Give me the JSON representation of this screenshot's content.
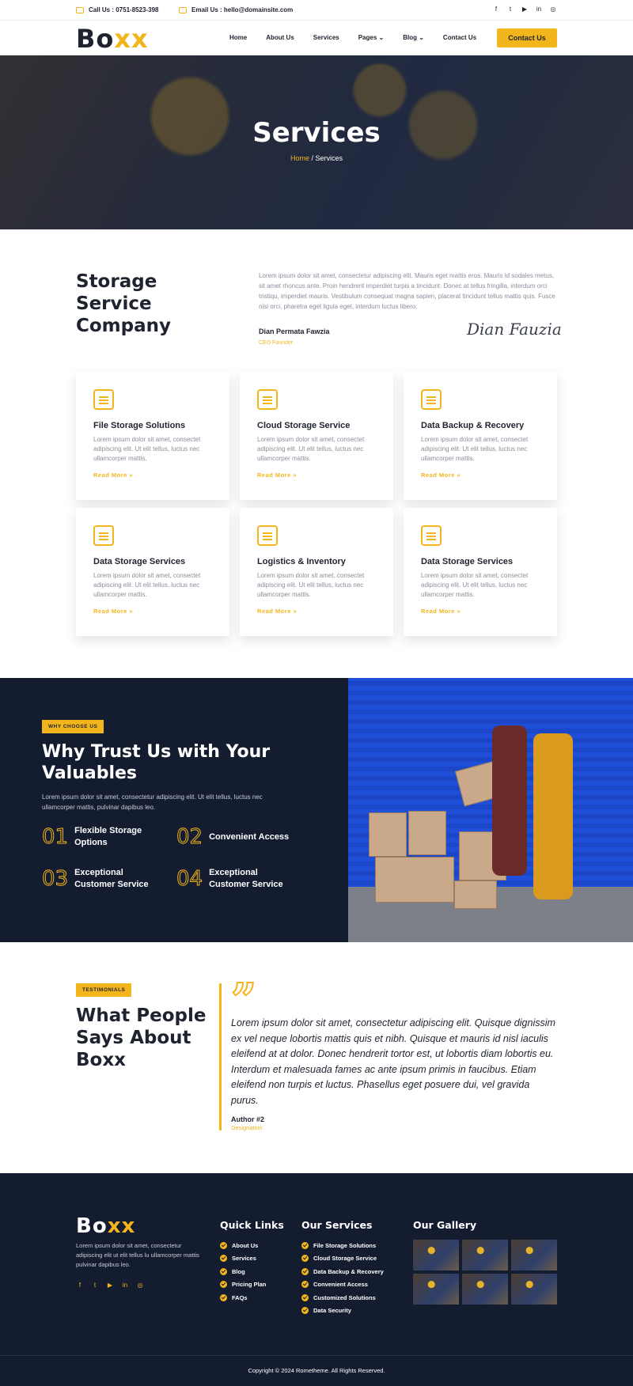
{
  "topbar": {
    "call": "Call Us : 0751-8523-398",
    "email": "Email Us : hello@domainsite.com",
    "socials": [
      "facebook-icon",
      "twitter-icon",
      "youtube-icon",
      "linkedin-icon",
      "instagram-icon"
    ]
  },
  "nav": {
    "logo_main": "Bo",
    "logo_accent": "xx",
    "items": [
      {
        "label": "Home"
      },
      {
        "label": "About Us"
      },
      {
        "label": "Services"
      },
      {
        "label": "Pages ⌄"
      },
      {
        "label": "Blog ⌄"
      },
      {
        "label": "Contact Us"
      }
    ],
    "cta": "Contact Us"
  },
  "hero": {
    "title": "Services",
    "crumb_home": "Home",
    "crumb_sep": " / ",
    "crumb_current": "Services"
  },
  "intro": {
    "title": "Storage Service Company",
    "text": "Lorem ipsum dolor sit amet, consectetur adipiscing elit. Mauris eget mattis eros. Mauris id sodales metus, sit amet rhoncus ante. Proin hendrerit imperdiet turpis a tincidunt. Donec at tellus fringilla, interdum orci tristiqu, imperdiet mauris. Vestibulum consequat magna sapien, placerat tincidunt tellus mattis quis. Fusce nisi orci, pharetra eget ligula eget, interdum luctus libero.",
    "author": "Dian Permata Fawzia",
    "role": "CEO Founder",
    "signature": "Dian Fauzia"
  },
  "services": [
    {
      "title": "File Storage Solutions",
      "text": "Lorem ipsum dolor sit amet, consectet adipiscing elit. Ut elit tellus, luctus nec ullamcorper mattis.",
      "more": "Read More »"
    },
    {
      "title": "Cloud Storage Service",
      "text": "Lorem ipsum dolor sit amet, consectet adipiscing elit. Ut elit tellus, luctus nec ullamcorper mattis.",
      "more": "Read More »"
    },
    {
      "title": "Data Backup & Recovery",
      "text": "Lorem ipsum dolor sit amet, consectet adipiscing elit. Ut elit tellus, luctus nec ullamcorper mattis.",
      "more": "Read More »"
    },
    {
      "title": "Data Storage Services",
      "text": "Lorem ipsum dolor sit amet, consectet adipiscing elit. Ut elit tellus, luctus nec ullamcorper mattis.",
      "more": "Read More »"
    },
    {
      "title": "Logistics & Inventory",
      "text": "Lorem ipsum dolor sit amet, consectet adipiscing elit. Ut elit tellus, luctus nec ullamcorper mattis.",
      "more": "Read More »"
    },
    {
      "title": "Data Storage Services",
      "text": "Lorem ipsum dolor sit amet, consectet adipiscing elit. Ut elit tellus, luctus nec ullamcorper mattis.",
      "more": "Read More »"
    }
  ],
  "why": {
    "tag": "WHY CHOOSE US",
    "title": "Why Trust Us with Your Valuables",
    "desc": "Lorem ipsum dolor sit amet, consectetur adipiscing elit. Ut elit tellus, luctus nec ullamcorper mattis, pulvinar dapibus leo.",
    "features": [
      {
        "num": "01",
        "label": "Flexible Storage Options"
      },
      {
        "num": "02",
        "label": "Convenient Access"
      },
      {
        "num": "03",
        "label": "Exceptional Customer Service"
      },
      {
        "num": "04",
        "label": "Exceptional Customer Service"
      }
    ]
  },
  "testimonial": {
    "tag": "TESTIMONIALS",
    "title": "What People Says About Boxx",
    "quote": "Lorem ipsum dolor sit amet, consectetur adipiscing elit. Quisque dignissim ex vel neque lobortis mattis quis et nibh. Quisque et mauris id nisl iaculis eleifend at at dolor. Donec hendrerit tortor est, ut lobortis diam lobortis eu. Interdum et malesuada fames ac ante ipsum primis in faucibus. Etiam eleifend non turpis et luctus. Phasellus eget posuere dui, vel gravida purus.",
    "author": "Author #2",
    "role": "Designation"
  },
  "footer": {
    "logo_main": "Bo",
    "logo_accent": "xx",
    "desc": "Lorem ipsum dolor sit amet, consectetur adipiscing elit ut elit tellus lu ullamcorper mattis pulvinar dapibus leo.",
    "quick_links_title": "Quick Links",
    "quick_links": [
      "About Us",
      "Services",
      "Blog",
      "Pricing Plan",
      "FAQs"
    ],
    "services_title": "Our Services",
    "services": [
      "File Storage Solutions",
      "Cloud Storage Service",
      "Data Backup & Recovery",
      "Convenient Access",
      "Customized Solutions",
      "Data Security"
    ],
    "gallery_title": "Our Gallery",
    "copyright": "Copyright © 2024 Rometheme. All Rights Reserved."
  },
  "colors": {
    "accent": "#f3b51c",
    "dark": "#141c30",
    "text": "#1f2330"
  }
}
